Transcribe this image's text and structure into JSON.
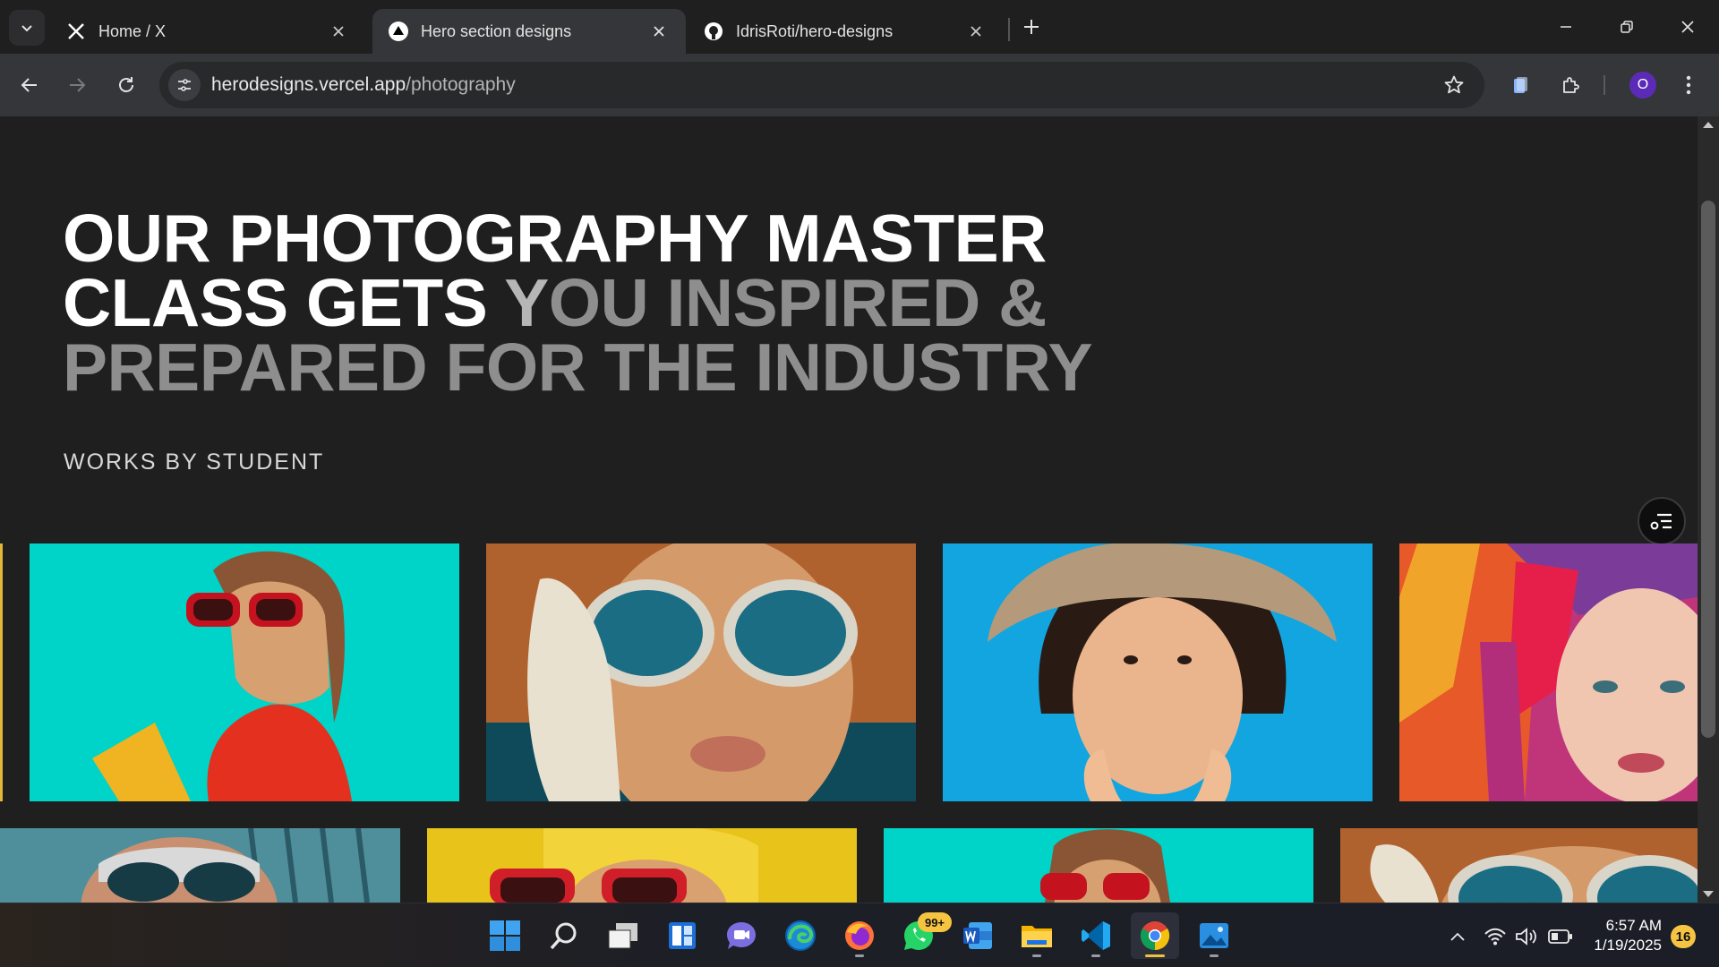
{
  "browser": {
    "tabs": [
      {
        "title": "Home / X",
        "favicon": "x-logo-icon",
        "active": false
      },
      {
        "title": "Hero section designs",
        "favicon": "vercel-triangle-icon",
        "active": true
      },
      {
        "title": "IdrisRoti/hero-designs",
        "favicon": "github-icon",
        "active": false
      }
    ],
    "url_host": "herodesigns.vercel.app",
    "url_path": "/photography",
    "profile_initial": "O"
  },
  "hero": {
    "title_line1": "OUR PHOTOGRAPHY MASTER",
    "title_line2_bright": "CLASS GETS ",
    "title_line2_mid": "Y",
    "title_line2_dim": "OU INSPIRED &",
    "title_line3": "PREPARED FOR THE INDUSTRY",
    "subtitle": "WORKS BY STUDENT"
  },
  "gallery": {
    "row1": [
      {
        "subject": "woman in red sunglasses with chips on teal",
        "bg": "#00d3c8"
      },
      {
        "subject": "woman in mirrored sunglasses with white glove",
        "bg": "#b0622e"
      },
      {
        "subject": "child in straw hat on blue",
        "bg": "#13a5df"
      },
      {
        "subject": "woman with colorful feathers",
        "bg": "#c0357a"
      }
    ],
    "row2": [
      {
        "subject": "woman with sunglasses under glass building",
        "bg": "#3a7a88"
      },
      {
        "subject": "woman in red sunglasses on yellow",
        "bg": "#e8c31a"
      },
      {
        "subject": "woman in red sunglasses on teal",
        "bg": "#00d3c8"
      },
      {
        "subject": "woman in mirrored sunglasses",
        "bg": "#b0622e"
      }
    ]
  },
  "taskbar": {
    "apps": [
      "windows-start-icon",
      "search-icon",
      "task-view-icon",
      "widgets-icon",
      "chat-icon",
      "edge-icon",
      "firefox-icon",
      "whatsapp-icon",
      "word-icon",
      "file-explorer-icon",
      "vscode-icon",
      "chrome-icon",
      "photos-icon"
    ],
    "whatsapp_badge": "99+",
    "time": "6:57 AM",
    "date": "1/19/2025",
    "notifications": "16"
  }
}
